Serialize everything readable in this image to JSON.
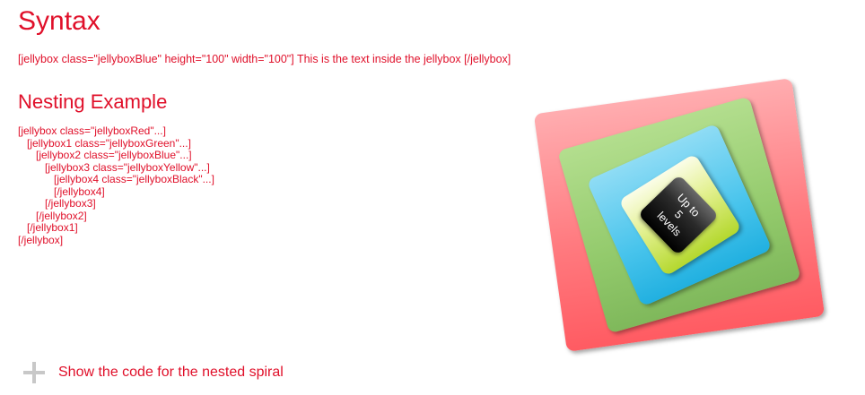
{
  "syntax": {
    "title": "Syntax",
    "example": "[jellybox class=\"jellyboxBlue\" height=\"100\" width=\"100\"] This is the text inside the jellybox [/jellybox]"
  },
  "nesting": {
    "title": "Nesting Example",
    "code_lines": [
      "[jellybox class=\"jellyboxRed\"...]",
      "   [jellybox1 class=\"jellyboxGreen\"...]",
      "      [jellybox2 class=\"jellyboxBlue\"...]",
      "         [jellybox3 class=\"jellyboxYellow\"...]",
      "            [jellybox4 class=\"jellyboxBlack\"...]",
      "            [/jellybox4]",
      "         [/jellybox3]",
      "      [/jellybox2]",
      "   [/jellybox1]",
      "[/jellybox]"
    ]
  },
  "jellybox_demo": {
    "text_lines": [
      "Up to",
      "5",
      "levels"
    ],
    "colors": {
      "red": "#ff7b80",
      "green": "#93ca6c",
      "blue": "#48c4ec",
      "yellow": "#d6ea6a",
      "black": "#111111"
    }
  },
  "toggle": {
    "label": "Show the code for the nested spiral",
    "icon": "plus-icon"
  },
  "theme": {
    "text_color": "#e0102a"
  }
}
